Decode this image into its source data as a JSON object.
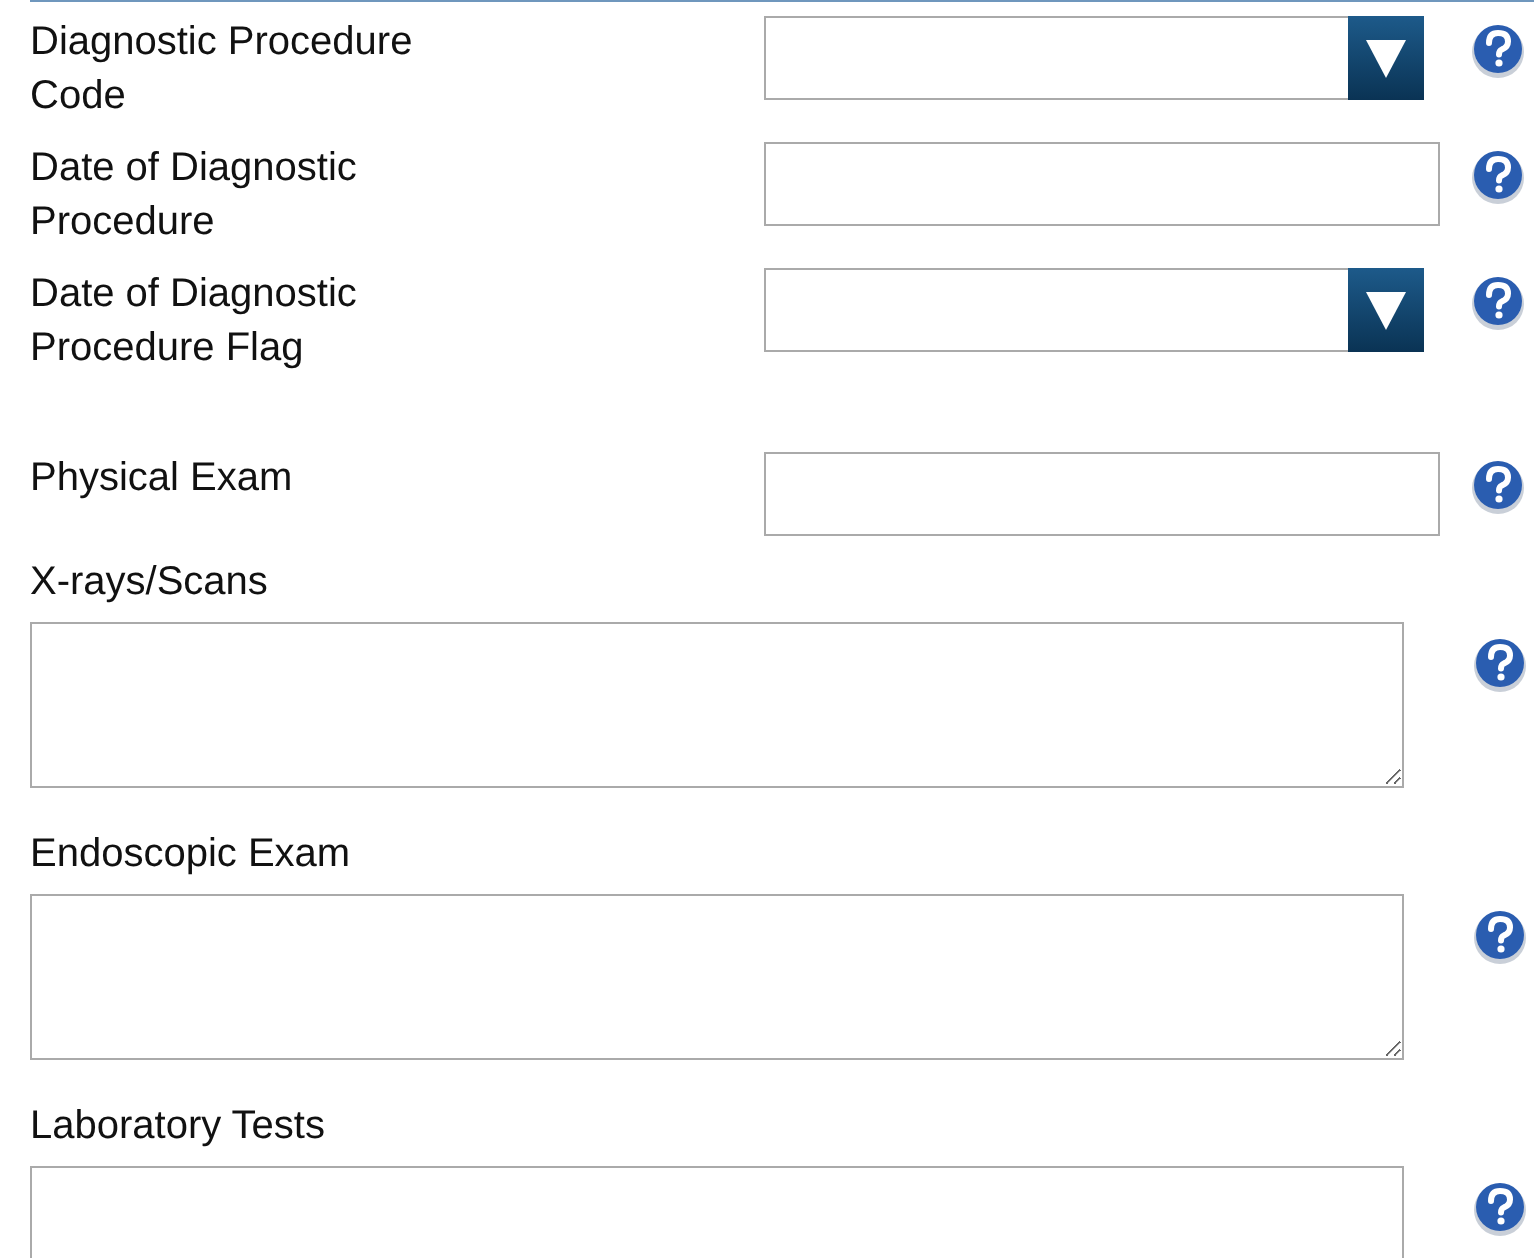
{
  "groups": [
    {
      "fields": [
        {
          "kind": "select",
          "label": "Diagnostic Procedure Code"
        },
        {
          "kind": "text",
          "label": "Date of Diagnostic Procedure"
        },
        {
          "kind": "select",
          "label": "Date of Diagnostic Procedure Flag"
        }
      ]
    },
    {
      "fields": [
        {
          "kind": "text",
          "label": "Physical Exam"
        },
        {
          "kind": "textarea",
          "label": "X-rays/Scans"
        },
        {
          "kind": "textarea",
          "label": "Endoscopic Exam"
        },
        {
          "kind": "textarea",
          "label": "Laboratory Tests"
        }
      ]
    }
  ]
}
